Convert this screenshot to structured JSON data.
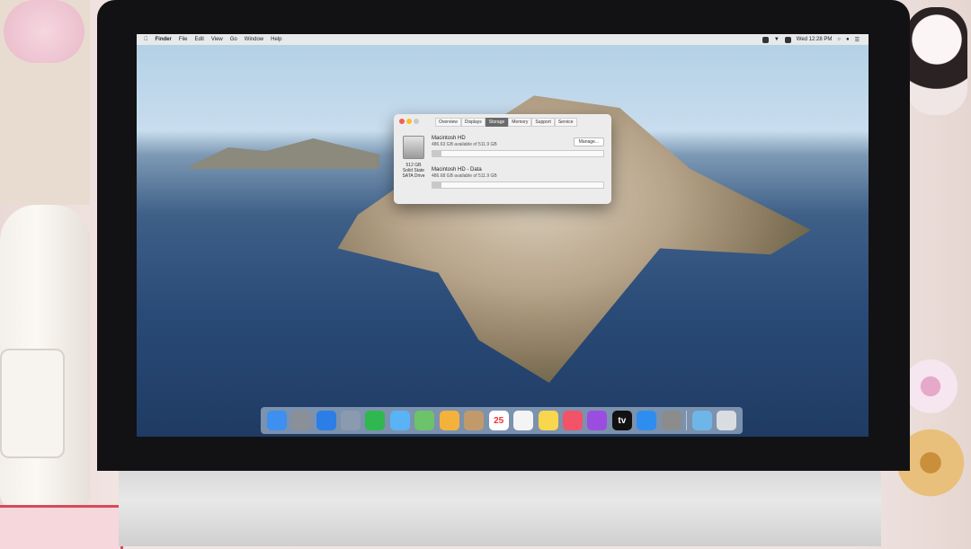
{
  "menubar": {
    "app_name": "Finder",
    "menus": [
      "File",
      "Edit",
      "View",
      "Go",
      "Window",
      "Help"
    ],
    "clock": "Wed 12:28 PM"
  },
  "window": {
    "tabs": [
      {
        "label": "Overview",
        "selected": false
      },
      {
        "label": "Displays",
        "selected": false
      },
      {
        "label": "Storage",
        "selected": true
      },
      {
        "label": "Memory",
        "selected": false
      },
      {
        "label": "Support",
        "selected": false
      },
      {
        "label": "Service",
        "selected": false
      }
    ],
    "disk_caption": {
      "size": "512 GB",
      "type_line1": "Solid State",
      "type_line2": "SATA Drive"
    },
    "manage_label": "Manage...",
    "volumes": [
      {
        "name": "Macintosh HD",
        "available": "486.63 GB available of 511.9 GB",
        "used_fraction": 0.05
      },
      {
        "name": "Macintosh HD - Data",
        "available": "486.68 GB available of 511.9 GB",
        "used_fraction": 0.05
      }
    ]
  },
  "dock": {
    "items": [
      {
        "icon": "finder-icon",
        "color": "#3d8ff0"
      },
      {
        "icon": "launchpad-icon",
        "color": "#8a8f98"
      },
      {
        "icon": "safari-icon",
        "color": "#2a7ee6"
      },
      {
        "icon": "photo-booth-icon",
        "color": "#8a9bb0"
      },
      {
        "icon": "facetime-icon",
        "color": "#2fb84f"
      },
      {
        "icon": "messages-icon",
        "color": "#5ab3f5"
      },
      {
        "icon": "maps-icon",
        "color": "#6cc36a"
      },
      {
        "icon": "photos-icon",
        "color": "#f3b23c"
      },
      {
        "icon": "contacts-icon",
        "color": "#c19a6b"
      },
      {
        "icon": "calendar-icon",
        "color": "#ffffff",
        "text": "25"
      },
      {
        "icon": "reminders-icon",
        "color": "#f4f4f4"
      },
      {
        "icon": "notes-icon",
        "color": "#f8d64e"
      },
      {
        "icon": "music-icon",
        "color": "#f25369"
      },
      {
        "icon": "podcasts-icon",
        "color": "#9b4de0"
      },
      {
        "icon": "apple-tv-icon",
        "color": "#111111",
        "text": "tv"
      },
      {
        "icon": "app-store-icon",
        "color": "#2d8ef0"
      },
      {
        "icon": "system-preferences-icon",
        "color": "#8c8c8c"
      },
      {
        "icon": "downloads-folder-icon",
        "color": "#6fb6e8"
      },
      {
        "icon": "trash-icon",
        "color": "#d9dde2"
      }
    ]
  }
}
